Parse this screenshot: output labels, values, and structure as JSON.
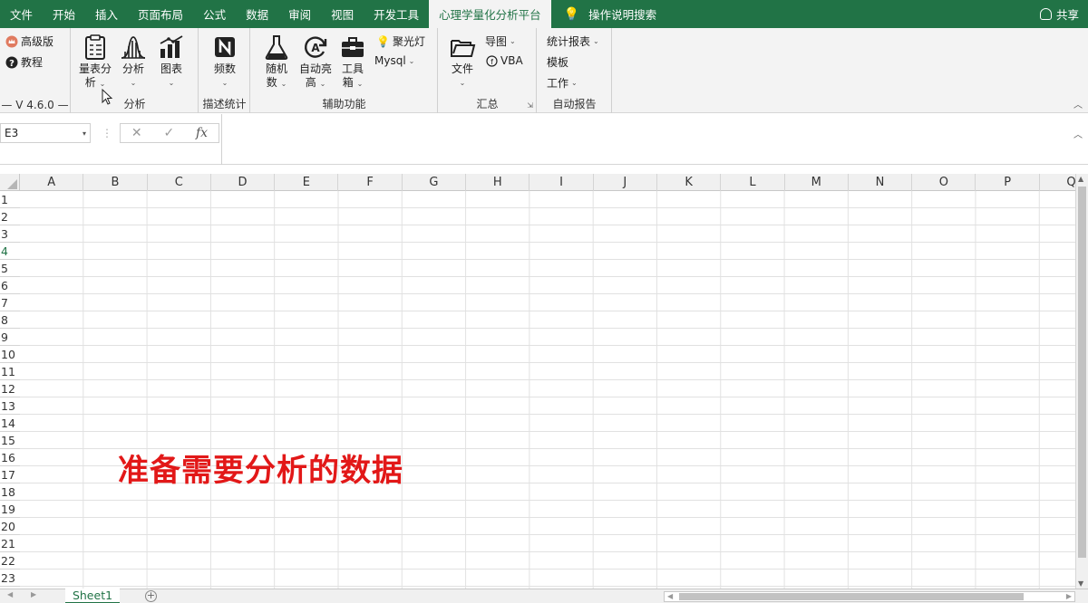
{
  "tabs": [
    "文件",
    "开始",
    "插入",
    "页面布局",
    "公式",
    "数据",
    "审阅",
    "视图",
    "开发工具",
    "心理学量化分析平台"
  ],
  "search_tab": "操作说明搜索",
  "share": "共享",
  "ribbon": {
    "g1": {
      "advanced": "高级版",
      "tutorial": "教程",
      "version": "V 4.6.0"
    },
    "g2": {
      "label": "分析",
      "btn1_line1": "量表分",
      "btn1_line2": "析",
      "btn2": "分析",
      "btn3": "图表"
    },
    "g3": {
      "label": "描述统计",
      "btn1": "频数"
    },
    "g4": {
      "label": "辅助功能",
      "btn1_line1": "随机",
      "btn1_line2": "数",
      "btn2_line1": "自动亮",
      "btn2_line2": "高",
      "btn3_line1": "工具",
      "btn3_line2": "箱",
      "spotlight": "聚光灯",
      "mysql": "Mysql"
    },
    "g5": {
      "label": "汇总",
      "file": "文件",
      "guide": "导图",
      "vba": "VBA"
    },
    "g6": {
      "label": "自动报告",
      "stats": "统计报表",
      "template": "模板",
      "work": "工作"
    }
  },
  "namebox": "E3",
  "fx": "fx",
  "columns": [
    "A",
    "B",
    "C",
    "D",
    "E",
    "F",
    "G",
    "H",
    "I",
    "J",
    "K",
    "L",
    "M",
    "N",
    "O",
    "P",
    "Q"
  ],
  "rows": [
    "1",
    "2",
    "3",
    "4",
    "5",
    "6",
    "7",
    "8",
    "9",
    "10",
    "11",
    "12",
    "13",
    "14",
    "15",
    "16",
    "17",
    "18",
    "19",
    "20",
    "21",
    "22",
    "23"
  ],
  "overlay_text": "准备需要分析的数据",
  "sheet_tab": "Sheet1",
  "colors": {
    "accent": "#217346",
    "overlay": "#e21818"
  }
}
